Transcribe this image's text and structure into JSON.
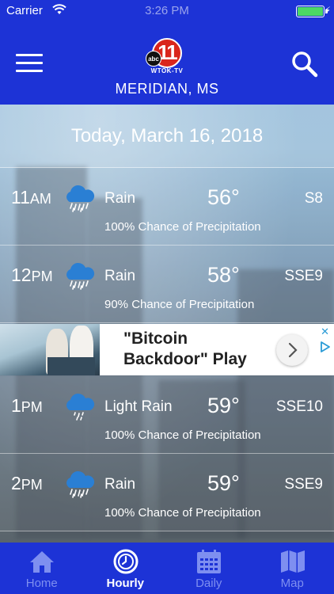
{
  "status_bar": {
    "carrier": "Carrier",
    "time": "3:26 PM"
  },
  "header": {
    "logo_number": "11",
    "logo_abc": "abc",
    "logo_station": "WTOK-TV",
    "location": "MERIDIAN, MS"
  },
  "date_label": "Today, March 16, 2018",
  "hours": [
    {
      "time": "11",
      "ampm": "AM",
      "icon": "rain-cloud-icon",
      "condition": "Rain",
      "temp": "56°",
      "wind": "S8",
      "precip": "100% Chance of Precipitation"
    },
    {
      "time": "12",
      "ampm": "PM",
      "icon": "rain-cloud-icon",
      "condition": "Rain",
      "temp": "58°",
      "wind": "SSE9",
      "precip": "90% Chance of Precipitation"
    },
    {
      "time": "1",
      "ampm": "PM",
      "icon": "light-rain-cloud-icon",
      "condition": "Light Rain",
      "temp": "59°",
      "wind": "SSE10",
      "precip": "100% Chance of Precipitation"
    },
    {
      "time": "2",
      "ampm": "PM",
      "icon": "rain-cloud-icon",
      "condition": "Rain",
      "temp": "59°",
      "wind": "SSE9",
      "precip": "100% Chance of Precipitation"
    }
  ],
  "ad": {
    "title_line1": "\"Bitcoin",
    "title_line2": "Backdoor\" Play"
  },
  "tabs": [
    {
      "label": "Home",
      "icon": "home-icon",
      "active": false
    },
    {
      "label": "Hourly",
      "icon": "clock-icon",
      "active": true
    },
    {
      "label": "Daily",
      "icon": "calendar-icon",
      "active": false
    },
    {
      "label": "Map",
      "icon": "map-icon",
      "active": false
    }
  ],
  "colors": {
    "brand_blue": "#1d33d6",
    "inactive_tab": "#7e8ff0",
    "cloud_blue": "#2a7fd4",
    "battery_green": "#4cd964"
  }
}
